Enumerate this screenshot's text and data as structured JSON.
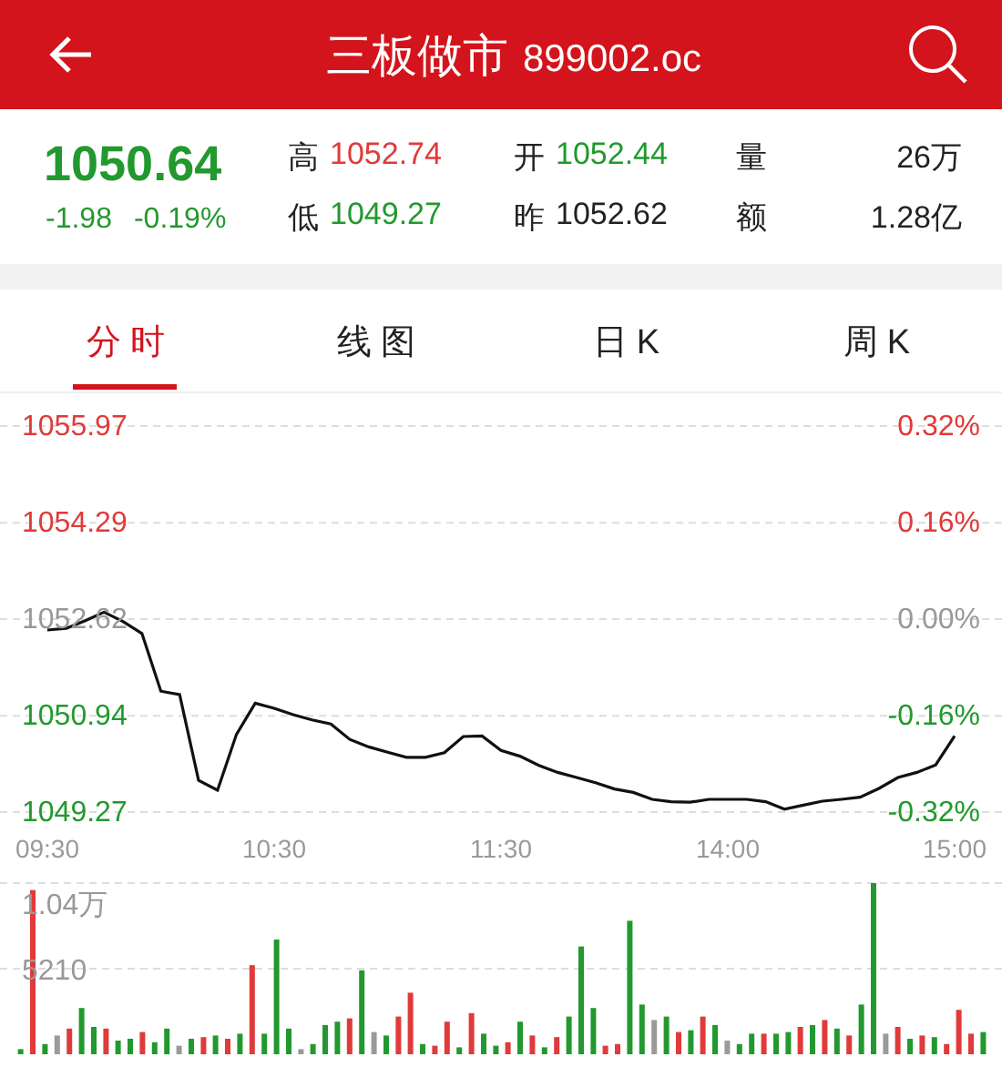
{
  "header": {
    "title": "三板做市",
    "code": "899002.oc"
  },
  "quote": {
    "price": "1050.64",
    "change": "-1.98",
    "change_pct": "-0.19%",
    "color": "#22992e",
    "stats": [
      {
        "label": "高",
        "value": "1052.74",
        "color": "#e03a3a"
      },
      {
        "label": "开",
        "value": "1052.44",
        "color": "#22992e"
      },
      {
        "label": "量",
        "value": "26万",
        "color": "#222222"
      },
      {
        "label": "低",
        "value": "1049.27",
        "color": "#22992e"
      },
      {
        "label": "昨",
        "value": "1052.62",
        "color": "#222222"
      },
      {
        "label": "额",
        "value": "1.28亿",
        "color": "#222222"
      }
    ]
  },
  "tabs": [
    {
      "label": "分时",
      "selected": true
    },
    {
      "label": "线图",
      "selected": false
    },
    {
      "label": "日K",
      "selected": false
    },
    {
      "label": "周K",
      "selected": false
    }
  ],
  "price_chart": {
    "right_labels": [
      "0.32%",
      "0.16%",
      "0.00%",
      "-0.16%",
      "-0.32%"
    ],
    "chart_data": {
      "type": "line",
      "grid": true,
      "ylim": [
        1049.27,
        1055.97
      ],
      "yticks": [
        {
          "value": 1055.97,
          "label": "1055.97"
        },
        {
          "value": 1054.29,
          "label": "1054.29"
        },
        {
          "value": 1052.62,
          "label": "1052.62"
        },
        {
          "value": 1050.94,
          "label": "1050.94"
        },
        {
          "value": 1049.27,
          "label": "1049.27"
        }
      ],
      "categories": [
        "09:30",
        null,
        null,
        null,
        null,
        null,
        null,
        null,
        null,
        null,
        null,
        null,
        "10:30",
        null,
        null,
        null,
        null,
        null,
        null,
        null,
        null,
        null,
        null,
        null,
        "11:30",
        null,
        null,
        null,
        null,
        null,
        null,
        null,
        null,
        null,
        null,
        null,
        "14:00",
        null,
        null,
        null,
        null,
        null,
        null,
        null,
        null,
        null,
        null,
        null,
        "15:00"
      ],
      "series": [
        {
          "color": "#111111",
          "values": [
            1052.43,
            1052.46,
            1052.59,
            1052.74,
            1052.58,
            1052.37,
            1051.37,
            1051.31,
            1049.82,
            1049.65,
            1050.62,
            1051.16,
            1051.07,
            1050.96,
            1050.87,
            1050.8,
            1050.53,
            1050.4,
            1050.31,
            1050.22,
            1050.22,
            1050.3,
            1050.58,
            1050.59,
            1050.34,
            1050.24,
            1050.08,
            1049.96,
            1049.87,
            1049.78,
            1049.67,
            1049.61,
            1049.49,
            1049.45,
            1049.44,
            1049.49,
            1049.49,
            1049.49,
            1049.45,
            1049.32,
            1049.39,
            1049.46,
            1049.49,
            1049.53,
            1049.68,
            1049.87,
            1049.96,
            1050.09,
            1050.59
          ]
        }
      ]
    }
  },
  "volume_chart": {
    "axis_labels": [
      "1.04万",
      "5210"
    ]
  }
}
